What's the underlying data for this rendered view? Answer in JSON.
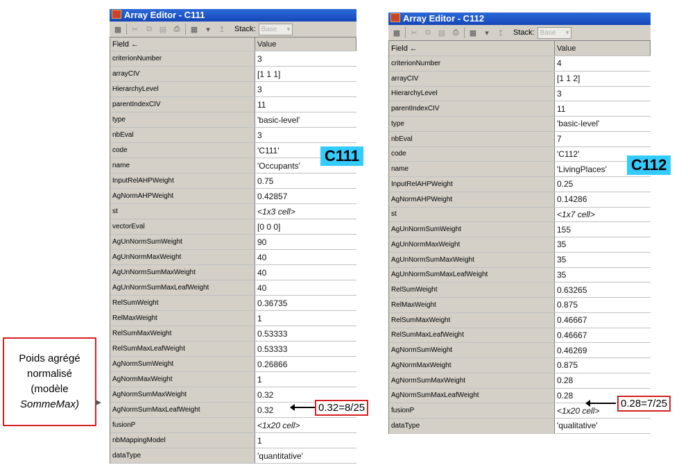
{
  "side_note": {
    "line1": "Poids agrégé",
    "line2": "normalisé",
    "line3": "(modèle",
    "line4": "SommeMax)"
  },
  "toolbar": {
    "stack_label": "Stack:",
    "stack_value": "Base"
  },
  "columns": {
    "field": "Field ←",
    "value": "Value"
  },
  "editors": [
    {
      "title": "Array Editor - C111",
      "badge": "C111",
      "annotation": "0.32=8/25",
      "rows": [
        {
          "field": "criterionNumber",
          "value": "3"
        },
        {
          "field": "arrayCIV",
          "value": "[1 1 1]"
        },
        {
          "field": "HierarchyLevel",
          "value": "3"
        },
        {
          "field": "parentIndexCIV",
          "value": "11"
        },
        {
          "field": "type",
          "value": "'basic-level'"
        },
        {
          "field": "nbEval",
          "value": "3"
        },
        {
          "field": "code",
          "value": "'C111'"
        },
        {
          "field": "name",
          "value": "'Occupants'"
        },
        {
          "field": "InputRelAHPWeight",
          "value": "0.75"
        },
        {
          "field": "AgNormAHPWeight",
          "value": "0.42857"
        },
        {
          "field": "st",
          "value": "<1x3 cell>"
        },
        {
          "field": "vectorEval",
          "value": "[0 0 0]"
        },
        {
          "field": "AgUnNormSumWeight",
          "value": "90"
        },
        {
          "field": "AgUnNormMaxWeight",
          "value": "40"
        },
        {
          "field": "AgUnNormSumMaxWeight",
          "value": "40"
        },
        {
          "field": "AgUnNormSumMaxLeafWeight",
          "value": "40"
        },
        {
          "field": "RelSumWeight",
          "value": "0.36735"
        },
        {
          "field": "RelMaxWeight",
          "value": "1"
        },
        {
          "field": "RelSumMaxWeight",
          "value": "0.53333"
        },
        {
          "field": "RelSumMaxLeafWeight",
          "value": "0.53333"
        },
        {
          "field": "AgNormSumWeight",
          "value": "0.26866"
        },
        {
          "field": "AgNormMaxWeight",
          "value": "1"
        },
        {
          "field": "AgNormSumMaxWeight",
          "value": "0.32"
        },
        {
          "field": "AgNormSumMaxLeafWeight",
          "value": "0.32"
        },
        {
          "field": "fusionP",
          "value": "<1x20 cell>"
        },
        {
          "field": "nbMappingModel",
          "value": "1"
        },
        {
          "field": "dataType",
          "value": "'quantitative'"
        }
      ]
    },
    {
      "title": "Array Editor - C112",
      "badge": "C112",
      "annotation": "0.28=7/25",
      "rows": [
        {
          "field": "criterionNumber",
          "value": "4"
        },
        {
          "field": "arrayCIV",
          "value": "[1 1 2]"
        },
        {
          "field": "HierarchyLevel",
          "value": "3"
        },
        {
          "field": "parentIndexCIV",
          "value": "11"
        },
        {
          "field": "type",
          "value": "'basic-level'"
        },
        {
          "field": "nbEval",
          "value": "7"
        },
        {
          "field": "code",
          "value": "'C112'"
        },
        {
          "field": "name",
          "value": "'LivingPlaces'"
        },
        {
          "field": "InputRelAHPWeight",
          "value": "0.25"
        },
        {
          "field": "AgNormAHPWeight",
          "value": "0.14286"
        },
        {
          "field": "st",
          "value": "<1x7 cell>"
        },
        {
          "field": "AgUnNormSumWeight",
          "value": "155"
        },
        {
          "field": "AgUnNormMaxWeight",
          "value": "35"
        },
        {
          "field": "AgUnNormSumMaxWeight",
          "value": "35"
        },
        {
          "field": "AgUnNormSumMaxLeafWeight",
          "value": "35"
        },
        {
          "field": "RelSumWeight",
          "value": "0.63265"
        },
        {
          "field": "RelMaxWeight",
          "value": "0.875"
        },
        {
          "field": "RelSumMaxWeight",
          "value": "0.46667"
        },
        {
          "field": "RelSumMaxLeafWeight",
          "value": "0.46667"
        },
        {
          "field": "AgNormSumWeight",
          "value": "0.46269"
        },
        {
          "field": "AgNormMaxWeight",
          "value": "0.875"
        },
        {
          "field": "AgNormSumMaxWeight",
          "value": "0.28"
        },
        {
          "field": "AgNormSumMaxLeafWeight",
          "value": "0.28"
        },
        {
          "field": "fusionP",
          "value": "<1x20 cell>"
        },
        {
          "field": "dataType",
          "value": "'qualitative'"
        }
      ]
    }
  ]
}
